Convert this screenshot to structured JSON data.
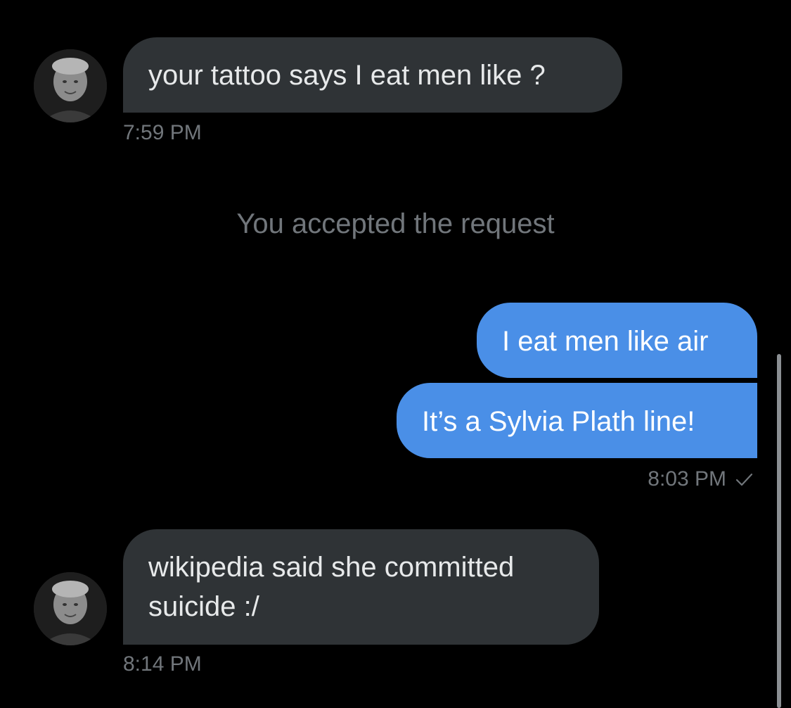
{
  "conversation": {
    "messages": [
      {
        "direction": "incoming",
        "text": "your tattoo says I eat men like ?",
        "time": "7:59 PM"
      },
      {
        "direction": "outgoing",
        "text": "I eat men like air"
      },
      {
        "direction": "outgoing",
        "text": "It’s a Sylvia Plath line!",
        "time": "8:03 PM"
      },
      {
        "direction": "incoming",
        "text": "wikipedia said she committed suicide :/",
        "time": "8:14 PM"
      }
    ],
    "system_note": "You accepted the request"
  },
  "colors": {
    "background": "#000000",
    "incoming_bubble": "#2f3336",
    "outgoing_bubble": "#4a8fe7",
    "muted_text": "#71767b"
  },
  "icons": {
    "avatar": "avatar-icon",
    "read_receipt": "check-icon"
  }
}
